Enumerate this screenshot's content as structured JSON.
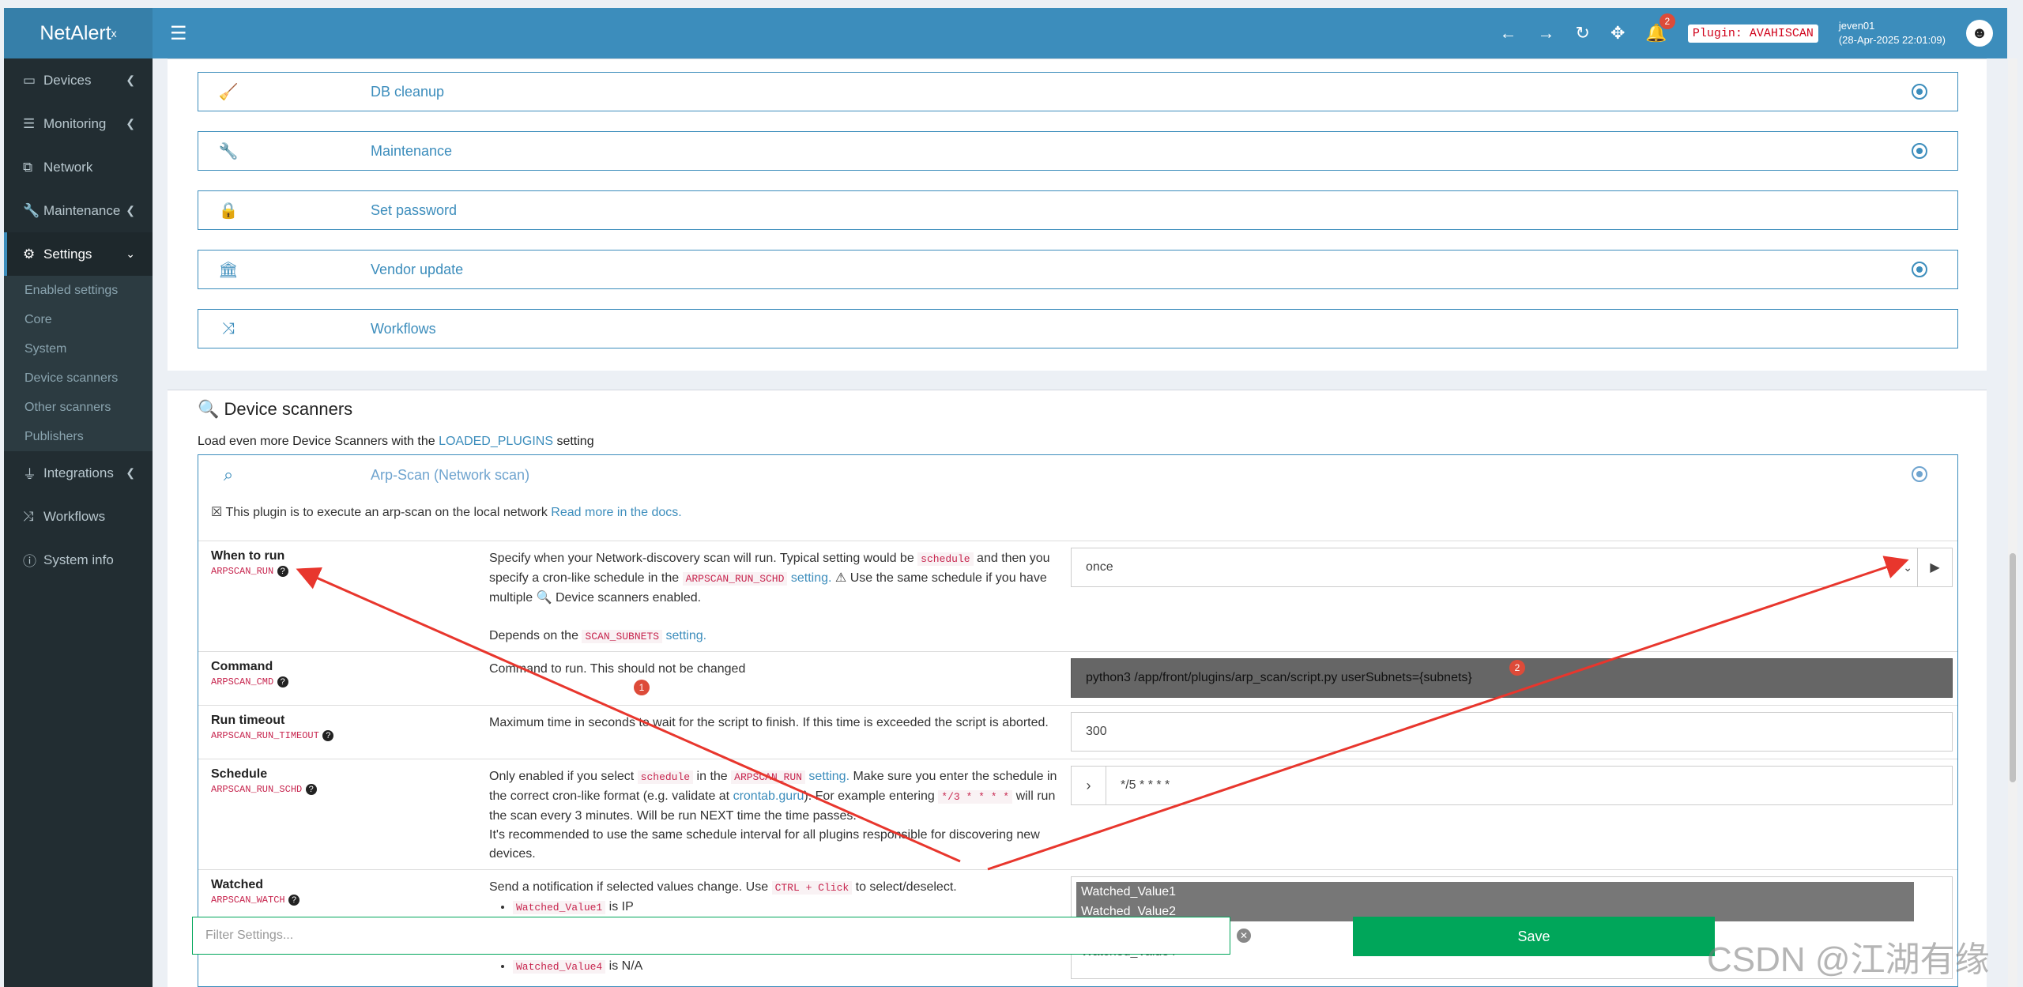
{
  "app": {
    "logo": "NetAlert",
    "logo_sup": "x"
  },
  "topbar": {
    "notifications": "2",
    "plugin_badge": "Plugin: AVAHISCAN",
    "user_name": "jeven01",
    "user_time": "(28-Apr-2025 22:01:09)"
  },
  "sidebar": {
    "items": [
      {
        "label": "Devices"
      },
      {
        "label": "Monitoring"
      },
      {
        "label": "Network"
      },
      {
        "label": "Maintenance"
      },
      {
        "label": "Settings"
      }
    ],
    "sub_items": [
      {
        "label": "Enabled settings"
      },
      {
        "label": "Core"
      },
      {
        "label": "System"
      },
      {
        "label": "Device scanners"
      },
      {
        "label": "Other scanners"
      },
      {
        "label": "Publishers"
      }
    ],
    "items2": [
      {
        "label": "Integrations"
      },
      {
        "label": "Workflows"
      },
      {
        "label": "System info"
      }
    ]
  },
  "panels": [
    {
      "title": "DB cleanup"
    },
    {
      "title": "Maintenance"
    },
    {
      "title": "Set password"
    },
    {
      "title": "Vendor update"
    },
    {
      "title": "Workflows"
    }
  ],
  "device_scanners": {
    "title": "Device scanners",
    "subtitle_pre": "Load even more Device Scanners with the",
    "subtitle_link": "LOADED_PLUGINS",
    "subtitle_post": "setting",
    "plugin_title": "Arp-Scan (Network scan)",
    "plugin_desc": "☒ This plugin is to execute an arp-scan on the local network",
    "plugin_desc_link": "Read more in the docs."
  },
  "settings": {
    "when_to_run": {
      "name": "When to run",
      "key": "ARPSCAN_RUN",
      "d1": "Specify when your Network-discovery scan will run. Typical setting would be",
      "d1_code": "schedule",
      "d2": "and then you specify a cron-like schedule in the",
      "d2_code": "ARPSCAN_RUN_SCHD",
      "d2_link": "setting.",
      "d3": "⚠ Use the same schedule if you have multiple 🔍 Device scanners enabled.",
      "d4": "Depends on the",
      "d4_code": "SCAN_SUBNETS",
      "d4_link": "setting.",
      "value": "once"
    },
    "command": {
      "name": "Command",
      "key": "ARPSCAN_CMD",
      "desc": "Command to run. This should not be changed",
      "value": "python3 /app/front/plugins/arp_scan/script.py userSubnets={subnets}"
    },
    "run_timeout": {
      "name": "Run timeout",
      "key": "ARPSCAN_RUN_TIMEOUT",
      "desc": "Maximum time in seconds to wait for the script to finish. If this time is exceeded the script is aborted.",
      "value": "300"
    },
    "schedule": {
      "name": "Schedule",
      "key": "ARPSCAN_RUN_SCHD",
      "d1": "Only enabled if you select",
      "d1_code": "schedule",
      "d1b": "in the",
      "d1_code2": "ARPSCAN_RUN",
      "d1_link": "setting.",
      "d2": "Make sure you enter the schedule in the correct cron-like format (e.g. validate at",
      "d2_link": "crontab.guru",
      "d3": "). For example entering",
      "d3_code": "*/3 * * * *",
      "d4": "will run the scan every 3 minutes. Will be run NEXT time the time passes.",
      "d5": "It's recommended to use the same schedule interval for all plugins responsible for discovering new devices.",
      "value": "*/5 * * * *"
    },
    "watched": {
      "name": "Watched",
      "key": "ARPSCAN_WATCH",
      "d1": "Send a notification if selected values change. Use",
      "d1_code": "CTRL + Click",
      "d1b": "to select/deselect.",
      "items": [
        {
          "code": "Watched_Value1",
          "text": "is IP"
        },
        {
          "code": "Watched_Value4",
          "text": "is N/A"
        }
      ],
      "options": [
        "Watched_Value1",
        "Watched_Value2",
        "Watched_Value4"
      ]
    }
  },
  "annotations": {
    "badge1": "1",
    "badge2": "2"
  },
  "footer": {
    "filter_placeholder": "Filter Settings...",
    "save_label": "Save"
  },
  "watermark": "CSDN @江湖有缘",
  "colors": {
    "primary": "#3c8dbc",
    "sidebar": "#222d32",
    "save": "#00a65a",
    "annotation": "#e8362d"
  }
}
